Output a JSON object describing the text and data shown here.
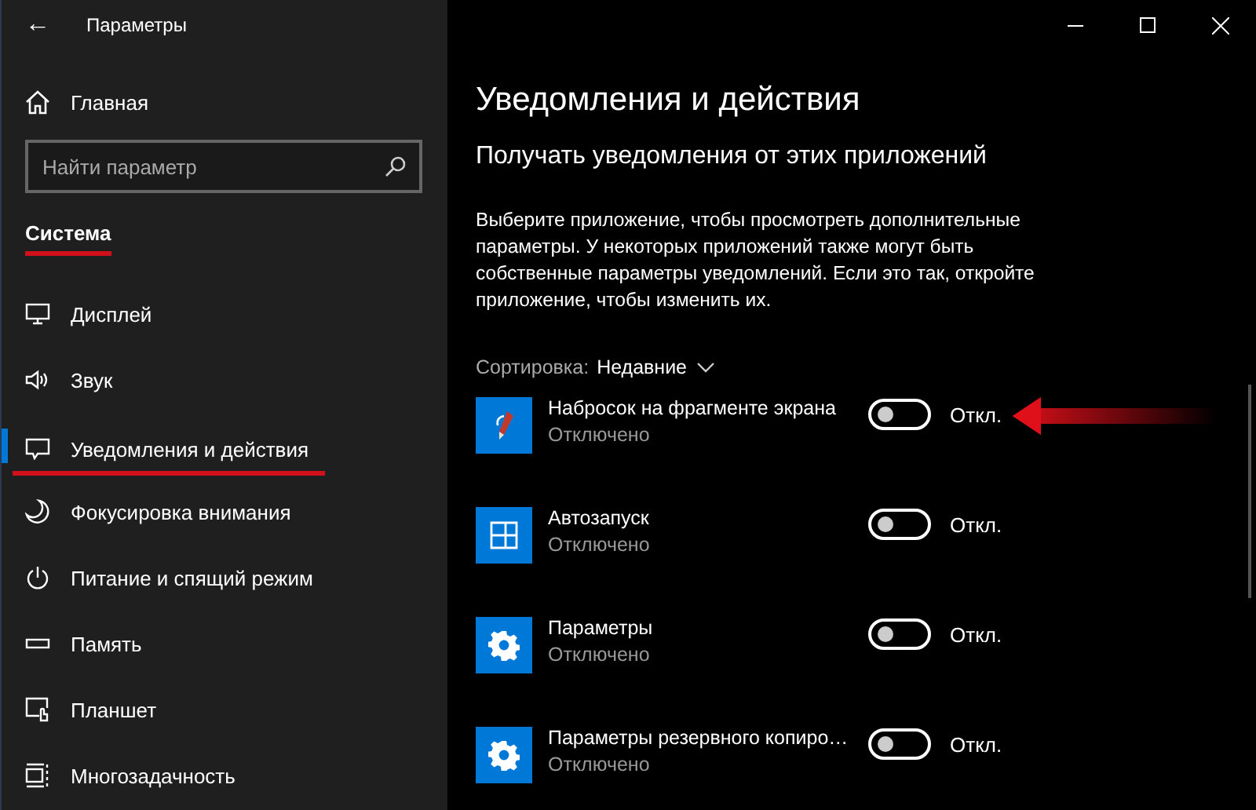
{
  "window": {
    "title": "Параметры",
    "back": "←"
  },
  "sidebar": {
    "home": {
      "label": "Главная"
    },
    "search": {
      "placeholder": "Найти параметр"
    },
    "section": {
      "label": "Система",
      "underlined": true
    },
    "items": [
      {
        "label": "Дисплей",
        "selected": false,
        "underlined": false
      },
      {
        "label": "Звук",
        "selected": false,
        "underlined": false
      },
      {
        "label": "Уведомления и действия",
        "selected": true,
        "underlined": true
      },
      {
        "label": "Фокусировка внимания",
        "selected": false,
        "underlined": false
      },
      {
        "label": "Питание и спящий режим",
        "selected": false,
        "underlined": false
      },
      {
        "label": "Память",
        "selected": false,
        "underlined": false
      },
      {
        "label": "Планшет",
        "selected": false,
        "underlined": false
      },
      {
        "label": "Многозадачность",
        "selected": false,
        "underlined": false
      }
    ]
  },
  "main": {
    "title": "Уведомления и действия",
    "subtitle": "Получать уведомления от этих приложений",
    "description": "Выберите приложение, чтобы просмотреть дополнительные параметры. У некоторых приложений также могут быть собственные параметры уведомлений. Если это так, откройте приложение, чтобы изменить их.",
    "sort": {
      "label": "Сортировка:",
      "value": "Недавние"
    },
    "apps": [
      {
        "name": "Набросок на фрагменте экрана",
        "status": "Отключено",
        "on": false,
        "toggle_label": "Откл.",
        "arrow": true
      },
      {
        "name": "Автозапуск",
        "status": "Отключено",
        "on": false,
        "toggle_label": "Откл.",
        "arrow": false
      },
      {
        "name": "Параметры",
        "status": "Отключено",
        "on": false,
        "toggle_label": "Откл.",
        "arrow": false
      },
      {
        "name": "Параметры резервного копиро…",
        "status": "Отключено",
        "on": false,
        "toggle_label": "Откл.",
        "arrow": false
      }
    ]
  }
}
